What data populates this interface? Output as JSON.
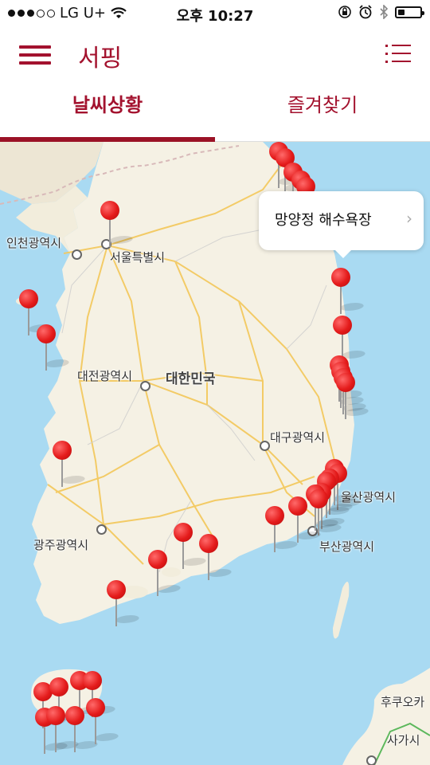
{
  "status_bar": {
    "carrier": "LG U+",
    "time": "오후 10:27",
    "signal_dots_filled": 3,
    "signal_dots_total": 5,
    "battery_level": 0.3,
    "icons": [
      "wifi-icon",
      "rotation-lock-icon",
      "alarm-icon",
      "bluetooth-icon",
      "battery-icon"
    ]
  },
  "header": {
    "title": "서핑",
    "menu_icon": "hamburger-menu-icon",
    "list_icon": "list-icon",
    "accent_color": "#a3122e"
  },
  "tabs": [
    {
      "label": "날씨상황",
      "selected": true
    },
    {
      "label": "즐겨찾기",
      "selected": false
    }
  ],
  "map": {
    "labels": [
      {
        "text": "인천광역시",
        "kind": "city"
      },
      {
        "text": "서울특별시",
        "kind": "city"
      },
      {
        "text": "대전광역시",
        "kind": "city"
      },
      {
        "text": "대한민국",
        "kind": "country"
      },
      {
        "text": "대구광역시",
        "kind": "city"
      },
      {
        "text": "울산광역시",
        "kind": "city"
      },
      {
        "text": "부산광역시",
        "kind": "city"
      },
      {
        "text": "광주광역시",
        "kind": "city"
      },
      {
        "text": "후쿠오카",
        "kind": "city"
      },
      {
        "text": "사가시",
        "kind": "city"
      }
    ],
    "callout": {
      "title": "망양정 해수욕장",
      "chevron": "chevron-right-icon"
    },
    "pin_count": 38,
    "colors": {
      "water": "#a9daf2",
      "land": "#f5f1e4",
      "pin": "#e41b1b",
      "road": "#f3c960"
    }
  }
}
